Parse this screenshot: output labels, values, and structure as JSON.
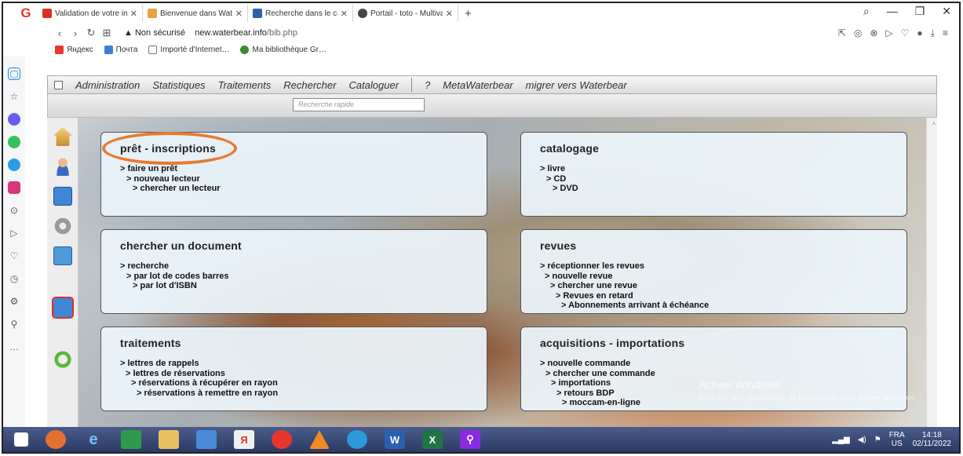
{
  "browser": {
    "tabs": [
      {
        "label": "Validation de votre inscripti",
        "favicon_color": "#d93025",
        "active": false
      },
      {
        "label": "Bienvenue dans WaterBear",
        "favicon_color": "#e8a33d",
        "active": true
      },
      {
        "label": "Recherche dans le catalogu",
        "favicon_color": "#2f5fa8",
        "active": false
      },
      {
        "label": "Portail - toto - Multivariate",
        "favicon_color": "#444444",
        "active": false
      }
    ],
    "new_tab": "+",
    "security_text": "Non sécurisé",
    "url_host": "new.waterbear.info",
    "url_path": "/bib.php",
    "bookmarks": [
      {
        "label": "Яндекс",
        "color": "#e8352d"
      },
      {
        "label": "Почта",
        "color": "#3d7fd8"
      },
      {
        "label": "Importé d'Internet…",
        "color": "#777777"
      },
      {
        "label": "Ma bibliothèque Gr…",
        "color": "#3a8a3a"
      }
    ]
  },
  "app": {
    "menu": [
      "Administration",
      "Statistiques",
      "Traitements",
      "Rechercher",
      "Cataloguer"
    ],
    "menu_help": "?",
    "menu_right": [
      "MetaWaterbear",
      "migrer vers Waterbear"
    ],
    "quick_search_placeholder": "Recherche rapide"
  },
  "cards": {
    "pret": {
      "title": "prêt - inscriptions",
      "links": [
        "> faire un prêt",
        "> nouveau lecteur",
        "> chercher un lecteur"
      ]
    },
    "catalogage": {
      "title": "catalogage",
      "links": [
        "> livre",
        "> CD",
        "> DVD"
      ]
    },
    "document": {
      "title": "chercher un document",
      "links": [
        "> recherche",
        "> par lot de codes barres",
        "> par lot d'ISBN"
      ]
    },
    "revues": {
      "title": "revues",
      "links": [
        "> réceptionner les revues",
        "> nouvelle revue",
        "> chercher une revue",
        "> Revues en retard",
        "> Abonnements arrivant à échéance"
      ]
    },
    "traitements": {
      "title": "traitements",
      "links": [
        "> lettres de rappels",
        "> lettres de réservations",
        "> réservations à récupérer en rayon",
        "> réservations à remettre en rayon"
      ]
    },
    "acquisitions": {
      "title": "acquisitions - importations",
      "links": [
        "> nouvelle commande",
        "> chercher une commande",
        "> importations",
        "> retours BDP",
        "> moccam-en-ligne"
      ]
    }
  },
  "watermark": {
    "title": "Activer Windows",
    "subtitle": "Accédez aux paramètres de l'ordinateur pour activer Windows."
  },
  "taskbar": {
    "lang_top": "FRA",
    "lang_bottom": "US",
    "time": "14:18",
    "date": "02/11/2022"
  }
}
